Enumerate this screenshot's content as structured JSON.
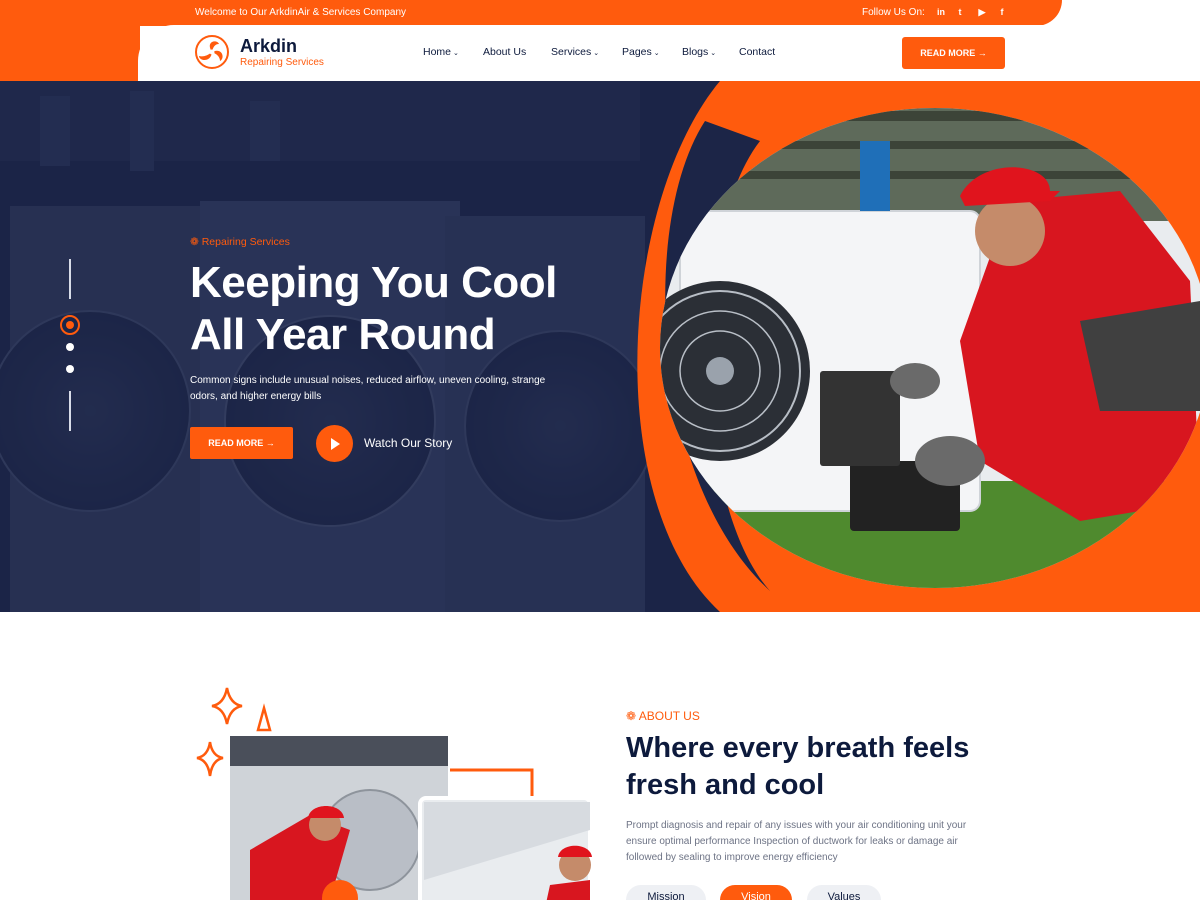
{
  "topbar": {
    "welcome": "Welcome to Our ArkdinAir & Services Company",
    "follow_label": "Follow Us On:",
    "social_icons": [
      "linkedin-icon",
      "twitter-icon",
      "youtube-icon",
      "facebook-icon"
    ],
    "social_glyphs": [
      "in",
      "t",
      "▶",
      "f"
    ]
  },
  "brand": {
    "name": "Arkdin",
    "tagline": "Repairing Services",
    "accent_color": "#ff5b0d",
    "navy_color": "#0d1a3c"
  },
  "nav": {
    "items": [
      {
        "label": "Home",
        "dropdown": "⌄"
      },
      {
        "label": "About Us",
        "dropdown": ""
      },
      {
        "label": "Services",
        "dropdown": "⌄"
      },
      {
        "label": "Pages",
        "dropdown": "⌄"
      },
      {
        "label": "Blogs",
        "dropdown": "⌄"
      },
      {
        "label": "Contact",
        "dropdown": ""
      }
    ],
    "cta": "READ MORE →"
  },
  "hero": {
    "tag": "❁ Repairing Services",
    "title_line1": "Keeping You Cool",
    "title_line2": "All Year Round",
    "description": "Common signs include unusual noises, reduced airflow, uneven cooling, strange odors, and higher energy bills",
    "button": "READ MORE →",
    "watch_label": "Watch Our Story",
    "active_slide": 1
  },
  "about": {
    "tag": "❁ ABOUT US",
    "title": "Where every breath feels fresh and cool",
    "description": "Prompt diagnosis and repair of any issues with your air conditioning unit your ensure optimal performance Inspection of ductwork for leaks or damage air followed by sealing to improve energy efficiency",
    "tabs": [
      "Mission",
      "Vision",
      "Values"
    ],
    "active_tab": "Vision"
  }
}
